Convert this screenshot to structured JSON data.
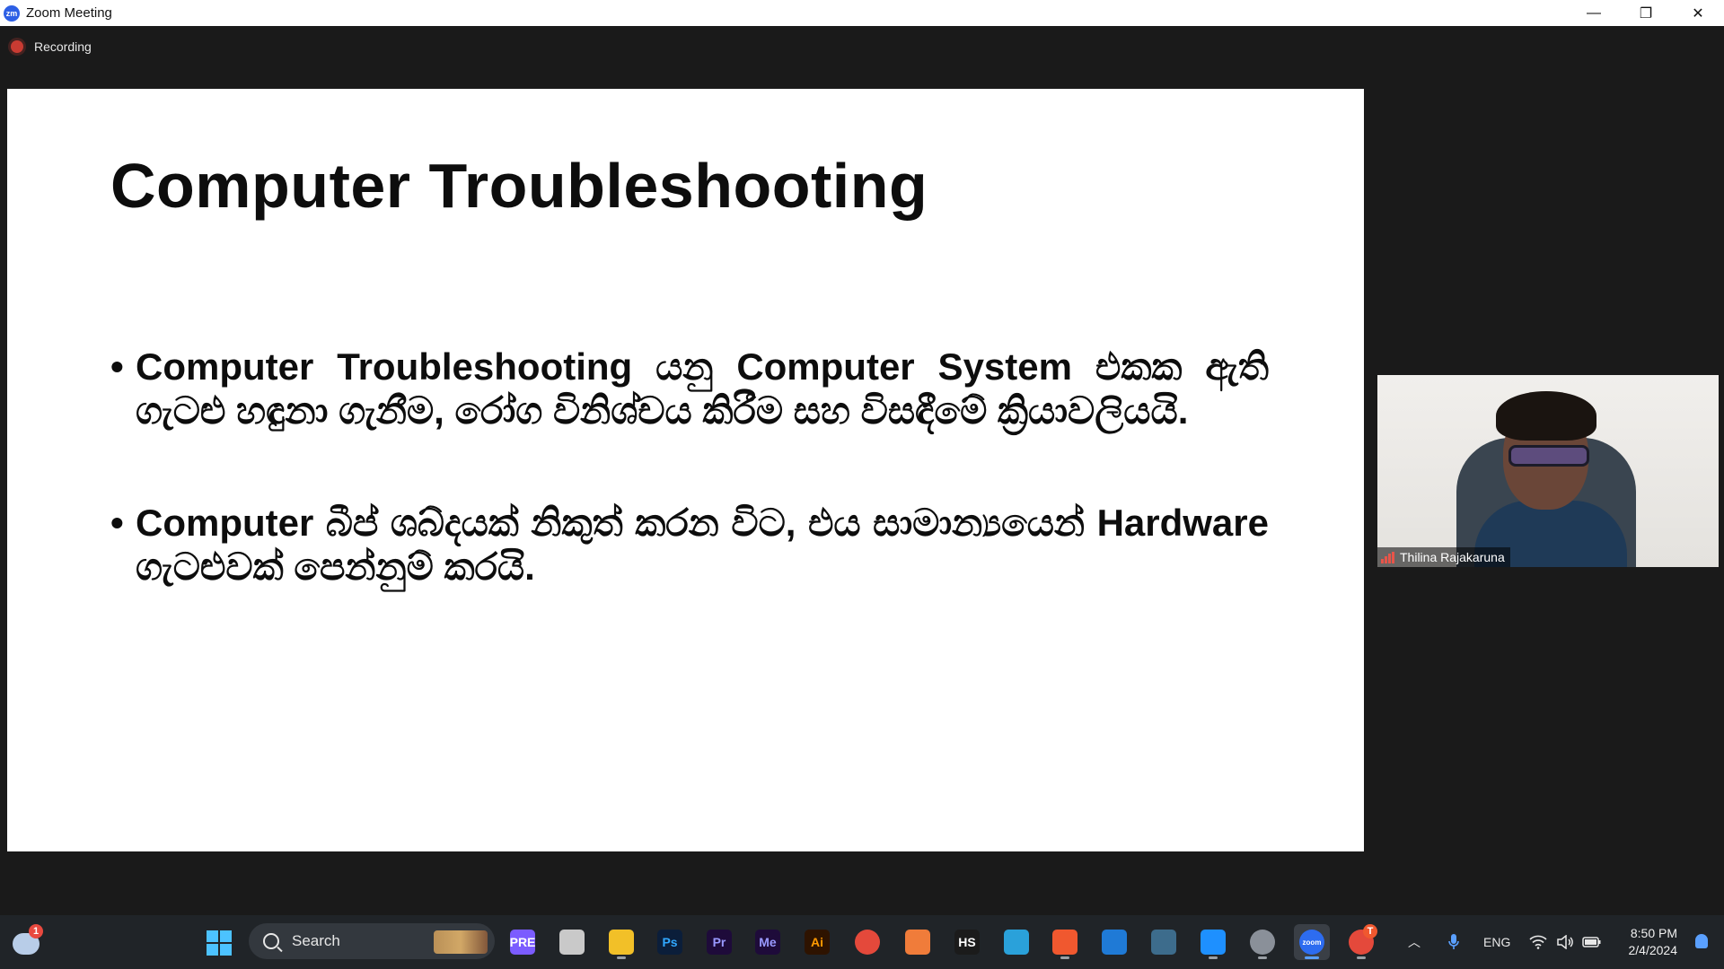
{
  "window": {
    "app_logo_text": "zm",
    "title": "Zoom Meeting",
    "minimize_glyph": "—",
    "maximize_glyph": "❐",
    "close_glyph": "✕"
  },
  "recording": {
    "label": "Recording",
    "color": "#c93b32"
  },
  "slide": {
    "title": "Computer Troubleshooting",
    "bullet_glyph": "•",
    "bullets": [
      {
        "text": "Computer Troubleshooting යනු Computer System එකක ඇති ගැටළු හඳුනා ගැනීම, රෝග විනිශ්චය කිරීම සහ විසඳීමේ ක්‍රියාවලියයි."
      },
      {
        "text": "Computer බීප් ශබ්දයක් නිකුත් කරන විට, එය සාමාන්‍යයෙන් Hardware ගැටළුවක් පෙන්නුම් කරයි."
      }
    ]
  },
  "participant": {
    "name": "Thilina Rajakaruna",
    "signal_color": "#e7554a"
  },
  "taskbar": {
    "weather_badge": "1",
    "search_placeholder": "Search",
    "apps": [
      {
        "name": "copilot",
        "label": "PRE",
        "color": "#7b5cff"
      },
      {
        "name": "task-view",
        "label": "",
        "color": "#c9c9c9"
      },
      {
        "name": "file-explorer",
        "label": "",
        "color": "#f2c028"
      },
      {
        "name": "photoshop",
        "label": "Ps",
        "color": "#0b1e3a",
        "text_color": "#31a8ff"
      },
      {
        "name": "premiere",
        "label": "Pr",
        "color": "#1e0b3a",
        "text_color": "#9999ff"
      },
      {
        "name": "media-encoder",
        "label": "Me",
        "color": "#1e0b3a",
        "text_color": "#9999ff"
      },
      {
        "name": "illustrator",
        "label": "Ai",
        "color": "#2e1300",
        "text_color": "#ff9a00"
      },
      {
        "name": "chrome",
        "label": "",
        "color": "#e4493b"
      },
      {
        "name": "xampp",
        "label": "",
        "color": "#f07c3a"
      },
      {
        "name": "hs-app",
        "label": "HS",
        "color": "#1b1b1b"
      },
      {
        "name": "telegram",
        "label": "",
        "color": "#2aa1da"
      },
      {
        "name": "brave",
        "label": "",
        "color": "#f0582f"
      },
      {
        "name": "vscode",
        "label": "",
        "color": "#1f7ad6"
      },
      {
        "name": "mysql-workbench",
        "label": "",
        "color": "#3d6c8c"
      },
      {
        "name": "sync-app",
        "label": "",
        "color": "#1e90ff"
      },
      {
        "name": "settings",
        "label": "",
        "color": "#8a9099"
      },
      {
        "name": "zoom",
        "label": "zoom",
        "color": "#2d6cf0"
      },
      {
        "name": "chrome-profile",
        "label": "",
        "color": "#e4493b"
      }
    ],
    "chrome_profile_badge": "T",
    "language": "ENG",
    "time": "8:50 PM",
    "date": "2/4/2024"
  }
}
